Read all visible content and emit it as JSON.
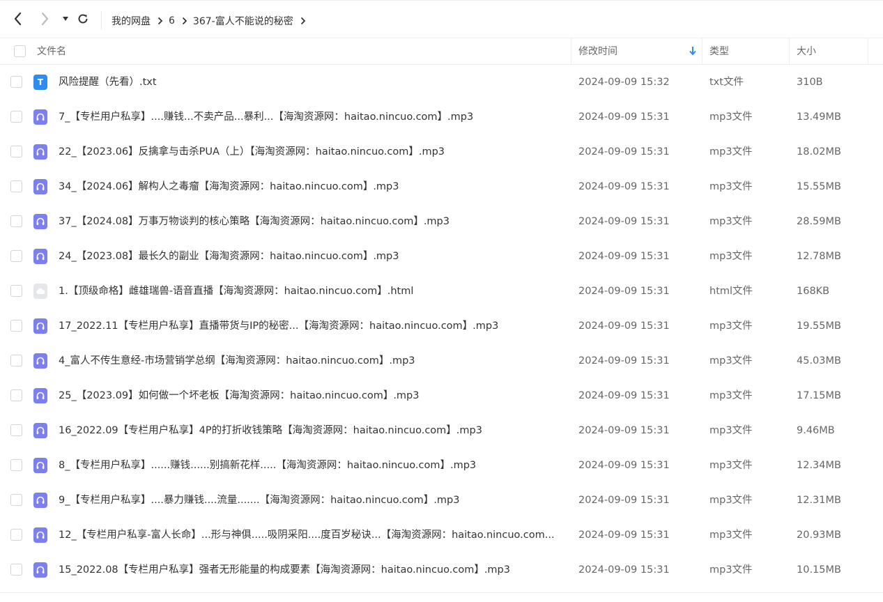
{
  "toolbar": {
    "back_icon": "chevron-left-icon",
    "forward_icon": "chevron-right-icon",
    "history_icon": "caret-down-icon",
    "refresh_icon": "refresh-icon"
  },
  "breadcrumb": [
    {
      "label": "我的网盘"
    },
    {
      "label": "6"
    },
    {
      "label": "367-富人不能说的秘密"
    }
  ],
  "columns": {
    "name": "文件名",
    "modified": "修改时间",
    "type": "类型",
    "size": "大小",
    "sort_icon": "sort-arrow-down-icon"
  },
  "colors": {
    "txt_icon": "#2e8cf0",
    "mp3_icon": "#7b7ff0",
    "html_icon": "#e4e6ea",
    "sort_arrow": "#2e8cf0"
  },
  "files": [
    {
      "name": "风险提醒（先看）.txt",
      "modified": "2024-09-09 15:32",
      "type": "txt文件",
      "size": "310B",
      "icon": "txt"
    },
    {
      "name": "7_【专栏用户私享】....赚钱...不卖产品...暴利...【海淘资源网：haitao.nincuo.com】.mp3",
      "modified": "2024-09-09 15:31",
      "type": "mp3文件",
      "size": "13.49MB",
      "icon": "mp3"
    },
    {
      "name": "22_【2023.06】反擒拿与击杀PUA（上）【海淘资源网：haitao.nincuo.com】.mp3",
      "modified": "2024-09-09 15:31",
      "type": "mp3文件",
      "size": "18.02MB",
      "icon": "mp3"
    },
    {
      "name": "34_【2024.06】解构人之毒瘤【海淘资源网：haitao.nincuo.com】.mp3",
      "modified": "2024-09-09 15:31",
      "type": "mp3文件",
      "size": "15.55MB",
      "icon": "mp3"
    },
    {
      "name": "37_【2024.08】万事万物谈判的核心策略【海淘资源网：haitao.nincuo.com】.mp3",
      "modified": "2024-09-09 15:31",
      "type": "mp3文件",
      "size": "28.59MB",
      "icon": "mp3"
    },
    {
      "name": "24_【2023.08】最长久的副业【海淘资源网：haitao.nincuo.com】.mp3",
      "modified": "2024-09-09 15:31",
      "type": "mp3文件",
      "size": "12.78MB",
      "icon": "mp3"
    },
    {
      "name": "1.【顶级命格】雌雄瑞兽-语音直播【海淘资源网：haitao.nincuo.com】.html",
      "modified": "2024-09-09 15:31",
      "type": "html文件",
      "size": "168KB",
      "icon": "html"
    },
    {
      "name": "17_2022.11【专栏用户私享】直播带货与IP的秘密...【海淘资源网：haitao.nincuo.com】.mp3",
      "modified": "2024-09-09 15:31",
      "type": "mp3文件",
      "size": "19.55MB",
      "icon": "mp3"
    },
    {
      "name": "4_富人不传生意经-市场营销学总纲【海淘资源网：haitao.nincuo.com】.mp3",
      "modified": "2024-09-09 15:31",
      "type": "mp3文件",
      "size": "45.03MB",
      "icon": "mp3"
    },
    {
      "name": "25_【2023.09】如何做一个坏老板【海淘资源网：haitao.nincuo.com】.mp3",
      "modified": "2024-09-09 15:31",
      "type": "mp3文件",
      "size": "17.15MB",
      "icon": "mp3"
    },
    {
      "name": "16_2022.09【专栏用户私享】4P的打折收钱策略【海淘资源网：haitao.nincuo.com】.mp3",
      "modified": "2024-09-09 15:31",
      "type": "mp3文件",
      "size": "9.46MB",
      "icon": "mp3"
    },
    {
      "name": "8_【专栏用户私享】......赚钱......别搞新花样.....【海淘资源网：haitao.nincuo.com】.mp3",
      "modified": "2024-09-09 15:31",
      "type": "mp3文件",
      "size": "12.34MB",
      "icon": "mp3"
    },
    {
      "name": "9_【专栏用户私享】....暴力赚钱....流量.......【海淘资源网：haitao.nincuo.com】.mp3",
      "modified": "2024-09-09 15:31",
      "type": "mp3文件",
      "size": "12.31MB",
      "icon": "mp3"
    },
    {
      "name": "12_【专栏用户私享-富人长命】...形与神俱.....吸阴采阳....度百岁秘诀...【海淘资源网：haitao.nincuo.com...",
      "modified": "2024-09-09 15:31",
      "type": "mp3文件",
      "size": "20.93MB",
      "icon": "mp3"
    },
    {
      "name": "15_2022.08【专栏用户私享】强者无形能量的构成要素【海淘资源网：haitao.nincuo.com】.mp3",
      "modified": "2024-09-09 15:31",
      "type": "mp3文件",
      "size": "10.15MB",
      "icon": "mp3"
    }
  ]
}
